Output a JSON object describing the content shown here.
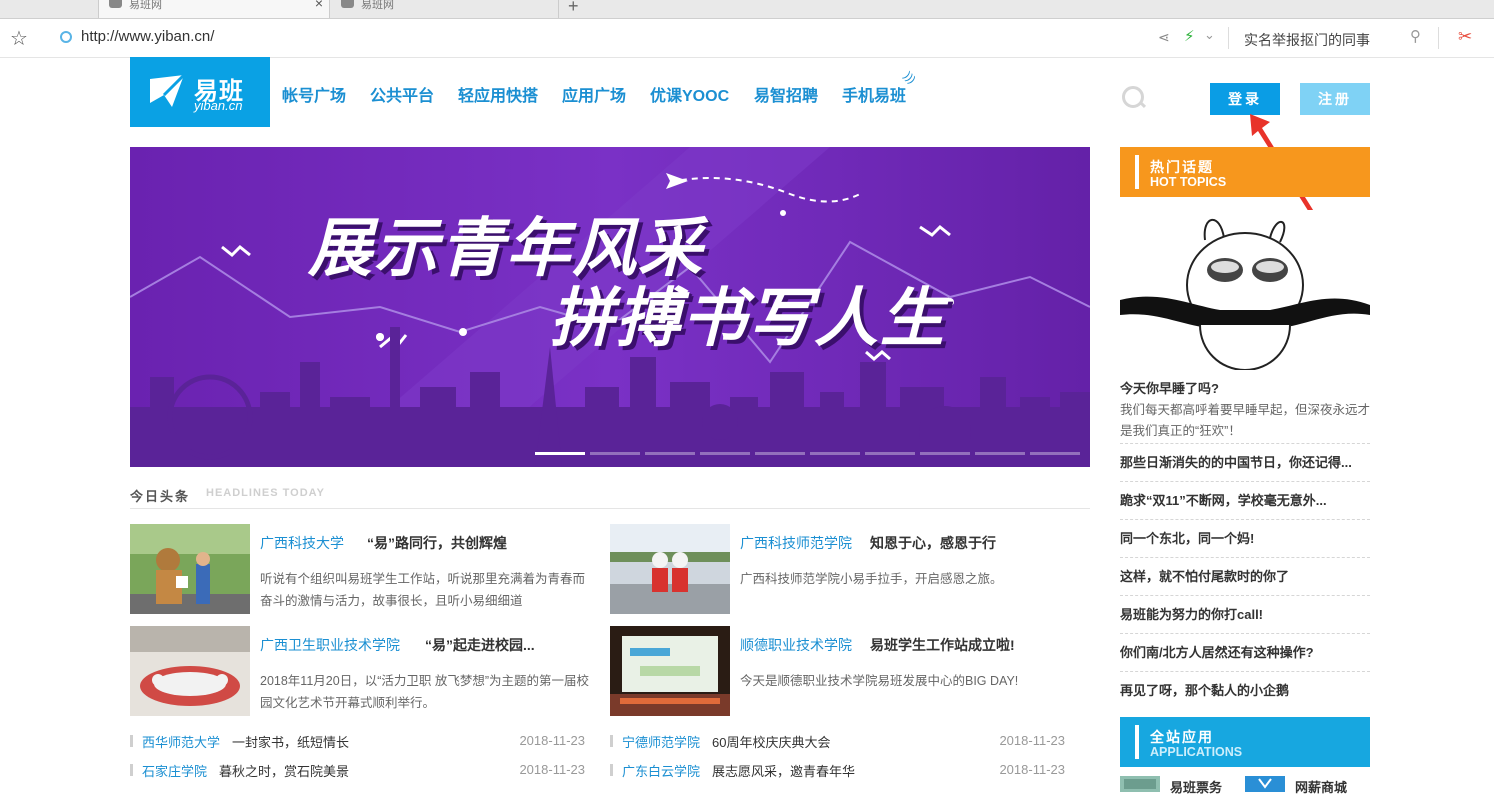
{
  "browser": {
    "tabs": [
      {
        "title": "易班网",
        "active": true
      },
      {
        "title": "易班网",
        "active": false
      }
    ],
    "new_tab": "+",
    "close": "×",
    "url": "http://www.yiban.cn/",
    "search_suggestion": "实名举报抠门的同事"
  },
  "site": {
    "logo": {
      "name": "易班",
      "domain": "yiban.cn"
    },
    "nav": [
      "帐号广场",
      "公共平台",
      "轻应用快搭",
      "应用广场",
      "优课YOOC",
      "易智招聘",
      "手机易班"
    ],
    "login": "登录",
    "register": "注册",
    "accent_color": "#0a9de5"
  },
  "banner": {
    "line1": "展示青年风采",
    "line2": "拼搏书写人生",
    "slide_count": 10,
    "active_slide": 1
  },
  "headlines": {
    "title": "今日头条",
    "subtitle": "HEADLINES TODAY",
    "items": [
      {
        "school": "广西科技大学",
        "title": "“易”路同行，共创辉煌",
        "desc": "听说有个组织叫易班学生工作站，听说那里充满着为青春而奋斗的激情与活力，故事很长，且听小易细细道"
      },
      {
        "school": "广西科技师范学院",
        "title": "知恩于心，感恩于行",
        "desc": "广西科技师范学院小易手拉手，开启感恩之旅。"
      },
      {
        "school": "广西卫生职业技术学院",
        "title": "“易”起走进校园...",
        "desc": "2018年11月20日，以“活力卫职 放飞梦想”为主题的第一届校园文化艺术节开幕式顺利举行。"
      },
      {
        "school": "顺德职业技术学院",
        "title": "易班学生工作站成立啦!",
        "desc": "今天是顺德职业技术学院易班发展中心的BIG DAY!"
      }
    ],
    "briefs": [
      {
        "school": "西华师范大学",
        "text": "一封家书，纸短情长",
        "date": "2018-11-23"
      },
      {
        "school": "宁德师范学院",
        "text": "60周年校庆庆典大会",
        "date": "2018-11-23"
      },
      {
        "school": "石家庄学院",
        "text": "暮秋之时，赏石院美景",
        "date": "2018-11-23"
      },
      {
        "school": "广东白云学院",
        "text": "展志愿风采，邀青春年华",
        "date": "2018-11-23"
      }
    ]
  },
  "sidebar": {
    "hot": {
      "title": "热门话题",
      "subtitle": "HOT TOPICS",
      "color": "#f7971d"
    },
    "featured": {
      "title": "今天你早睡了吗?",
      "desc": "我们每天都高呼着要早睡早起，但深夜永远才是我们真正的“狂欢”！"
    },
    "topics": [
      "那些日渐消失的的中国节日，你还记得...",
      "跪求“双11”不断网，学校毫无意外...",
      "同一个东北，同一个妈!",
      "这样，就不怕付尾款时的你了",
      "易班能为努力的你打call!",
      "你们南/北方人居然还有这种操作?",
      "再见了呀，那个黏人的小企鹅"
    ],
    "apps": {
      "title": "全站应用",
      "subtitle": "APPLICATIONS",
      "items": [
        "易班票务",
        "网薪商城"
      ],
      "color": "#17a7e0"
    }
  }
}
